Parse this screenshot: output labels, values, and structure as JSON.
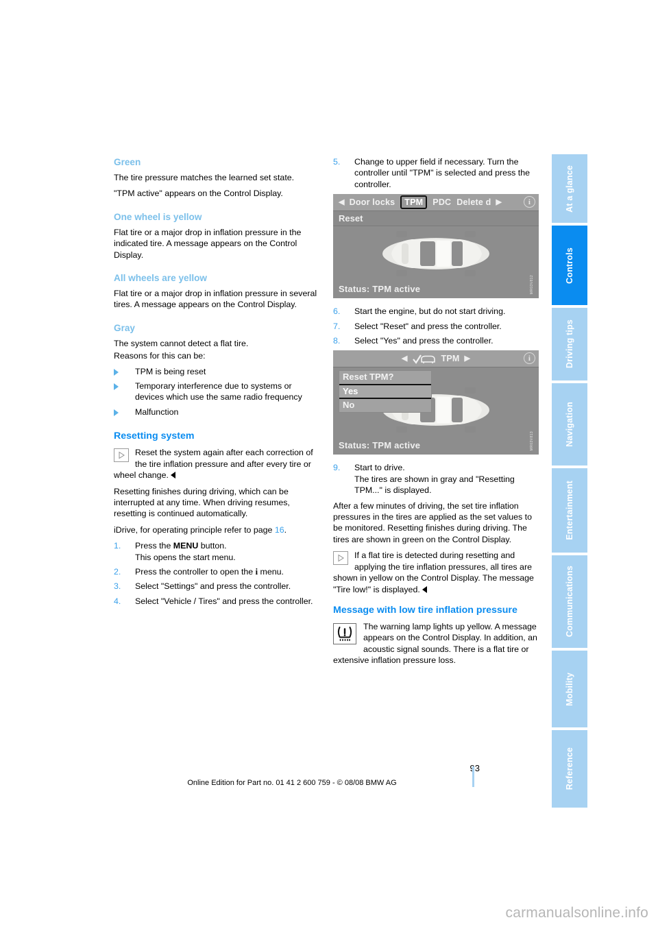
{
  "document": {
    "page_number": "93",
    "footer_note": "Online Edition for Part no. 01 41 2 600 759 - © 08/08 BMW AG",
    "watermark": "carmanualsonline.info"
  },
  "colors": {
    "heading_primary": "#0a8cf0",
    "heading_secondary": "#7cc0ea",
    "tab_inactive": "#a7d2f2",
    "tab_active": "#0a8cf0",
    "bullet": "#5cb2e8",
    "step_number": "#3aa0ea"
  },
  "tabs": [
    {
      "label": "At a glance",
      "active": false
    },
    {
      "label": "Controls",
      "active": true
    },
    {
      "label": "Driving tips",
      "active": false
    },
    {
      "label": "Navigation",
      "active": false
    },
    {
      "label": "Entertainment",
      "active": false
    },
    {
      "label": "Communications",
      "active": false
    },
    {
      "label": "Mobility",
      "active": false
    },
    {
      "label": "Reference",
      "active": false
    }
  ],
  "left_column": {
    "green": {
      "heading": "Green",
      "p1": "The tire pressure matches the learned set state.",
      "p2": "\"TPM active\" appears on the Control Display."
    },
    "one_wheel": {
      "heading": "One wheel is yellow",
      "p1": "Flat tire or a major drop in inflation pressure in the indicated tire. A message appears on the Control Display."
    },
    "all_wheels": {
      "heading": "All wheels are yellow",
      "p1": "Flat tire or a major drop in inflation pressure in several tires. A message appears on the Control Display."
    },
    "gray": {
      "heading": "Gray",
      "p1": "The system cannot detect a flat tire.",
      "p2": "Reasons for this can be:",
      "bullets": [
        "TPM is being reset",
        "Temporary interference due to systems or devices which use the same radio frequency",
        "Malfunction"
      ]
    },
    "resetting": {
      "heading": "Resetting system",
      "note": "Reset the system again after each correction of the tire inflation pressure and after every tire or wheel change.",
      "p1": "Resetting finishes during driving, which can be interrupted at any time. When driving resumes, resetting is continued automatically.",
      "p2_prefix": "iDrive, for operating principle refer to page ",
      "p2_link": "16",
      "p2_suffix": ".",
      "steps": [
        {
          "n": "1.",
          "line1_pre": "Press the ",
          "line1_kb": "MENU",
          "line1_post": " button.",
          "line2": "This opens the start menu."
        },
        {
          "n": "2.",
          "line1_pre": "Press the controller to open the ",
          "line1_kb": "i",
          "line1_post": " menu.",
          "line2": ""
        },
        {
          "n": "3.",
          "line1_pre": "Select \"Settings\" and press the controller.",
          "line1_kb": "",
          "line1_post": "",
          "line2": ""
        },
        {
          "n": "4.",
          "line1_pre": "Select \"Vehicle / Tires\" and press the controller.",
          "line1_kb": "",
          "line1_post": "",
          "line2": ""
        }
      ]
    }
  },
  "right_column": {
    "step5": {
      "n": "5.",
      "text": "Change to upper field if necessary. Turn the controller until \"TPM\" is selected and press the controller."
    },
    "screen1": {
      "menu_items": [
        "Door locks",
        "TPM",
        "PDC",
        "Delete d"
      ],
      "selected_menu_item": "TPM",
      "left_arrow": "◀",
      "right_arrow": "▶",
      "info_icon_label": "i",
      "subbar_label": "Reset",
      "status": "Status: TPM active",
      "caption_code": "MR03V812"
    },
    "steps_678": [
      {
        "n": "6.",
        "text": "Start the engine, but do not start driving."
      },
      {
        "n": "7.",
        "text": "Select \"Reset\" and press the controller."
      },
      {
        "n": "8.",
        "text": "Select \"Yes\" and press the controller."
      }
    ],
    "screen2": {
      "title": "TPM",
      "left_arrow": "◀",
      "right_arrow": "▶",
      "info_icon_label": "i",
      "dialog_title": "Reset TPM?",
      "dialog_options": [
        "Yes",
        "No"
      ],
      "dialog_selected": "Yes",
      "status": "Status: TPM active",
      "caption_code": "MR03V813"
    },
    "step9": {
      "n": "9.",
      "line1": "Start to drive.",
      "line2": "The tires are shown in gray and \"Resetting TPM...\" is displayed."
    },
    "after_para": "After a few minutes of driving, the set tire inflation pressures in the tires are applied as the set values to be monitored. Resetting finishes during driving. The tires are shown in green on the Control Display.",
    "note": "If a flat tire is detected during resetting and applying the tire inflation pressures, all tires are shown in yellow on the Control Display. The message \"Tire low!\" is displayed.",
    "low_pressure": {
      "heading": "Message with low tire inflation pressure",
      "text": "The warning lamp lights up yellow. A message appears on the Control Display. In addition, an acoustic signal sounds. There is a flat tire or extensive inflation pressure loss."
    }
  }
}
